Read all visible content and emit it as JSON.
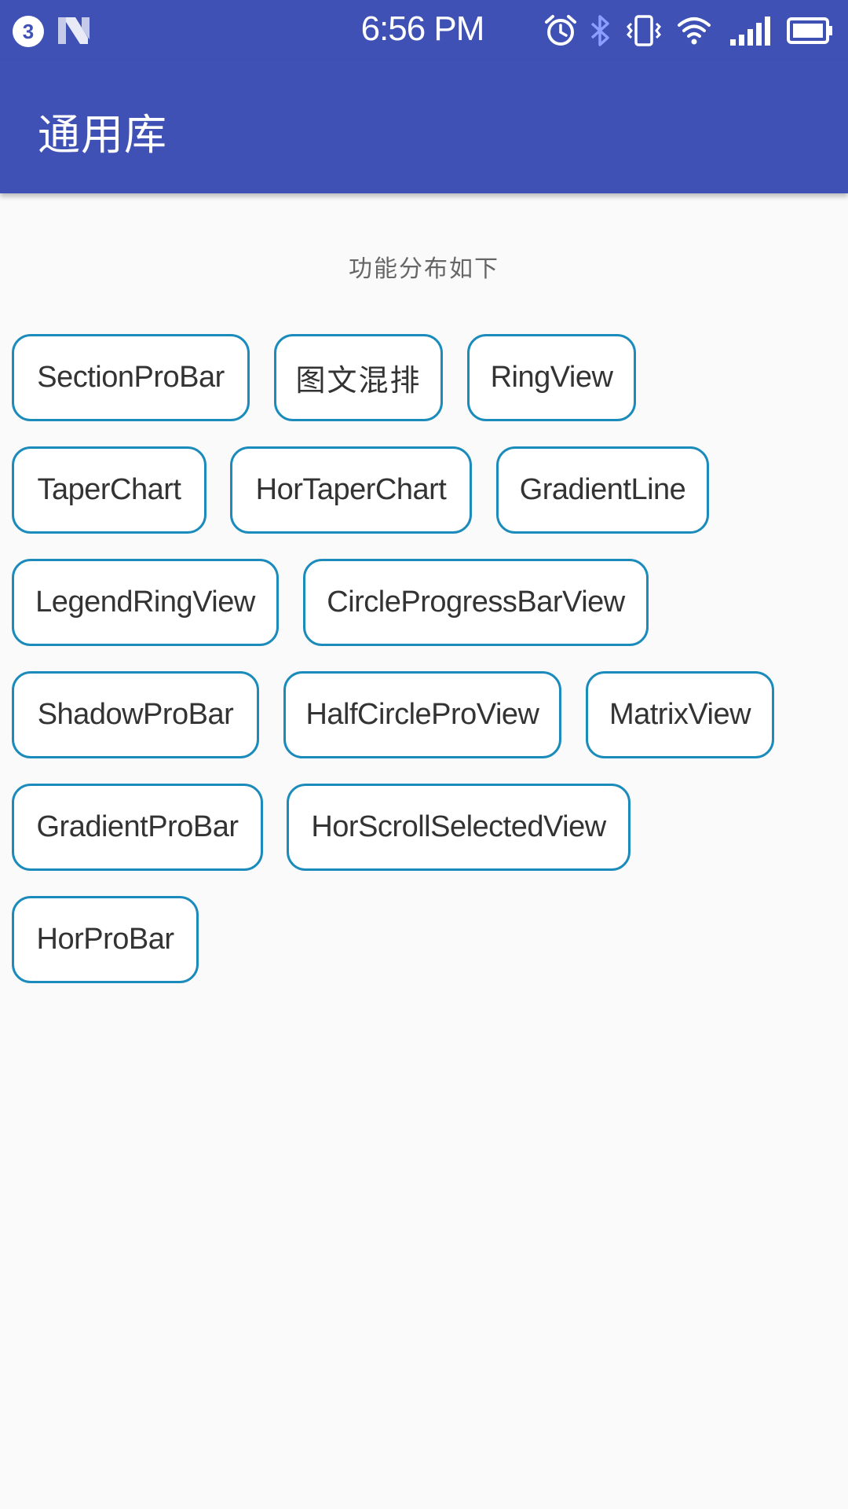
{
  "status_bar": {
    "notification_count": "3",
    "time": "6:56 PM",
    "icons": [
      "nougat-n-icon",
      "alarm-icon",
      "bluetooth-icon",
      "vibrate-icon",
      "wifi-icon",
      "signal-icon",
      "battery-icon"
    ]
  },
  "toolbar": {
    "title": "通用库"
  },
  "content": {
    "subtitle": "功能分布如下",
    "buttons": [
      "SectionProBar",
      "图文混排",
      "RingView",
      "TaperChart",
      "HorTaperChart",
      "GradientLine",
      "LegendRingView",
      "CircleProgressBarView",
      "ShadowProBar",
      "HalfCircleProView",
      "MatrixView",
      "GradientProBar",
      "HorScrollSelectedView",
      "HorProBar"
    ]
  },
  "colors": {
    "primary": "#3f51b5",
    "chip_border": "#1a8bba",
    "background": "#fafafa"
  }
}
